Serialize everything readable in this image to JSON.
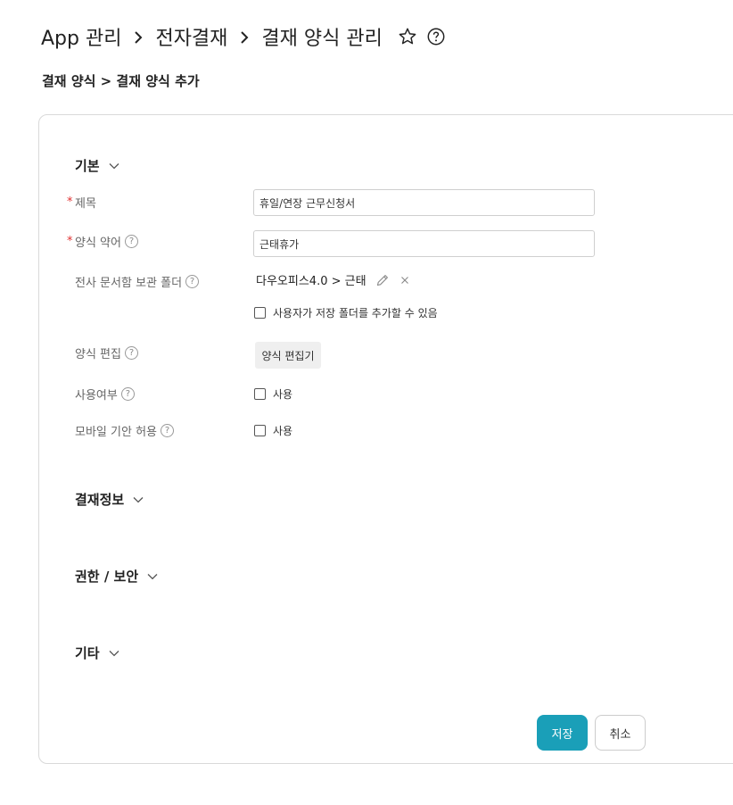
{
  "header": {
    "crumbs": [
      "App 관리",
      "전자결재",
      "결재 양식 관리"
    ],
    "star_icon": "star-outline-icon",
    "help_icon": "help-circle-icon"
  },
  "breadcrumb": "결재 양식 > 결재 양식 추가",
  "sections": {
    "basic": "기본",
    "approval_info": "결재정보",
    "permission": "권한 / 보안",
    "etc": "기타"
  },
  "fields": {
    "title": {
      "label": "제목",
      "required": true,
      "value": "휴일/연장 근무신청서"
    },
    "abbr": {
      "label": "양식 약어",
      "required": true,
      "value": "근태휴가"
    },
    "folder": {
      "label": "전사 문서함 보관 폴더",
      "path": "다우오피스4.0 >  근태",
      "checkbox_label": "사용자가 저장 폴더를 추가할 수 있음",
      "checked": false
    },
    "editor": {
      "label": "양식 편집",
      "button_label": "양식 편집기"
    },
    "usage": {
      "label": "사용여부",
      "checkbox_label": "사용",
      "checked": false
    },
    "mobile": {
      "label": "모바일 기안 허용",
      "checkbox_label": "사용",
      "checked": false
    }
  },
  "help_glyph": "?",
  "required_mark": "*",
  "actions": {
    "save": "저장",
    "cancel": "취소"
  },
  "colors": {
    "primary": "#1a9fb8",
    "required": "#e03131"
  }
}
